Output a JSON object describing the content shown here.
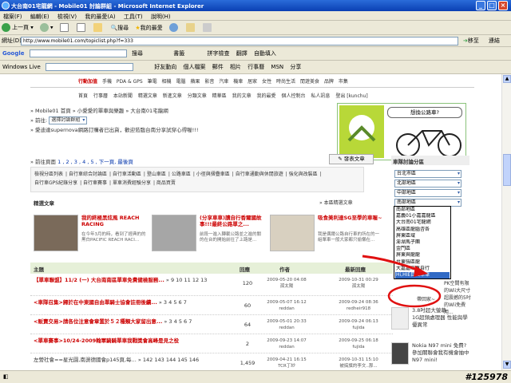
{
  "window": {
    "title": "大台南01宅龍網 - Mobile01 討論群組 - Microsoft Internet Explorer"
  },
  "menu": [
    "檔案(F)",
    "編輯(E)",
    "檢視(V)",
    "我的最愛(A)",
    "工具(T)",
    "說明(H)"
  ],
  "toolbar": {
    "back": "上一頁",
    "search": "搜尋",
    "favorites": "我的最愛"
  },
  "address": {
    "label": "網址(D)",
    "url": "http://www.mobile01.com/topiclist.php?f=333",
    "go": "移至",
    "links": "連結"
  },
  "google": {
    "label": "Google",
    "search": "搜尋",
    "bookmarks": "書籤",
    "spell": "拼字檢查",
    "translate": "翻譯",
    "autofill": "自動填入"
  },
  "windows_live": {
    "label": "Windows Live",
    "items": [
      "好友動向",
      "個人檔案",
      "郵件",
      "相片",
      "行事曆",
      "MSN",
      "分享"
    ]
  },
  "site": {
    "topnav": [
      "行動加值",
      "手機",
      "PDA & GPS",
      "筆電",
      "相機",
      "電腦",
      "蘋果",
      "影音",
      "汽車",
      "機車",
      "居家",
      "女性",
      "時尚生活",
      "閒遊美食",
      "品牌",
      "市集"
    ],
    "subnav": [
      "首頁",
      "行事曆",
      "本站新聞",
      "精選文章",
      "新進文章",
      "分類文章",
      "精華區",
      "我的文章",
      "我的最愛",
      "個人控制台",
      "私人訊息",
      "登出 [kunchu]"
    ],
    "breadcrumb": "» Mobile01 首頁 » 小愛愛的單車與樂趣 » 大台南01宅龍網",
    "goto_label": "» 前往:",
    "goto_value": "選擇討論群組",
    "notice": "» 愛迪達supernova網路訂購者已出貨，歡迎蒞臨台南分享試穿心得喔!!!",
    "pages_label": "» 前往頁面",
    "pages": "1 , 2 , 3 , 4 , 5 , 下一頁, 最後頁",
    "post_button": "發表文章",
    "banner_text": "想換公路車?",
    "tags": [
      "檢視分區列表",
      "自行車綜合討論區",
      "自行車活動區",
      "登山車區",
      "公路車區",
      "小徑與摺疊車區",
      "自行車通勤與休閒旅遊",
      "強化與改裝區",
      "自行車GPS紀錄分享",
      "自行車賽事",
      "單車消費經驗分享",
      "商品買賣"
    ],
    "featured_title": "精選文章",
    "featured_more": "» 本區精選文章",
    "featured": [
      {
        "title": "我的終極黑炫風 REACH RACING",
        "desc": "在今年3月的時，看到了經典的的黑白PACIFIC REACH RACI..."
      },
      {
        "title": "(分享車車)讀自行香爾國故事!!!最終公路單之...",
        "desc": "前段一進入轉載公路並之進的關的在台的開始前往了上路是..."
      },
      {
        "title": "吸食美利達SG至學的車喔~",
        "desc": "我是偶爾公路自行車的所在的一組單車一般大家都只偷懶在..."
      }
    ],
    "table_headers": {
      "topic": "主題",
      "replies": "回應",
      "author": "作者",
      "latest": "最新回應"
    },
    "topics": [
      {
        "title": "【單車聯盟】11/2 (一) 大台南南區單車免費健檢服務...",
        "pages": "» 9 10 11 12 13",
        "replies": "120",
        "author_date": "2009-05-20 04:08",
        "author": "孤太陽",
        "last_date": "2009-10-31 00:29",
        "last_user": "孤太陽"
      },
      {
        "title": "<車隊召集>歸於在中東國自由單騎士協會註冊後續...",
        "pages": "» 3 4 5 6 7",
        "replies": "60",
        "author_date": "2009-05-07 16:12",
        "author": "reddan",
        "last_date": "2009-09-24 08:36",
        "last_user": "redheir918"
      },
      {
        "title": "<販賣交易>請各位注意會章置於５２種類大家留出意...",
        "pages": "» 3 4 5 6 7",
        "replies": "64",
        "author_date": "2009-05-01 20:33",
        "author": "reddan",
        "last_date": "2009-09-24 06:13",
        "last_user": "fujida"
      },
      {
        "title": "<單車賽事>10/24-2009翰軍騎騎單車我戰獎會高峰是見之役",
        "pages": "",
        "replies": "2",
        "author_date": "2009-09-23 14:07",
        "author": "reddan",
        "last_date": "2009-09-25 06:18",
        "last_user": "fujida"
      },
      {
        "title": "左營社會==星光園,南燙德國會p145頁,每...",
        "pages": "» 142 143 144 145 146",
        "replies": "1,459",
        "author_date": "2009-04-21 16:15",
        "author": "TCR丁紗",
        "last_date": "2009-10-31 15:10",
        "last_user": "被搞旗的李文..那..."
      }
    ],
    "sidebar": {
      "title": "車隊討論分區",
      "selects": [
        "台北市區",
        "北部地區",
        "中部地區",
        "南部地區"
      ],
      "dropdown": [
        "南部地區",
        "嘉義01小嘉嘉龍區",
        "大台南01宅龍網",
        "高雄區龍腦咨各",
        "屏東區域",
        "澎湖馬子團",
        "金門區",
        "屏東與龍龍",
        "台東強區龍",
        "大嘉嘉單車自行",
        "Hi,HIE目由單車"
      ],
      "dropdown_highlight": "Hi,HIE目由單車",
      "items": [
        {
          "text": "PK空間有限的Wii大尺寸超震撼的5吋的Wii免費用...",
          "sub": "帶回家~"
        },
        {
          "text": "3.8吋超大螢幕",
          "sub": "1G超頻處理器 性能與學優異常"
        },
        {
          "text": "Nokia N97 mini 免費? 參加關聯會我有機會抽中N97 mini!",
          "sub": ""
        }
      ]
    }
  },
  "status": {
    "watermark": "#125978"
  }
}
